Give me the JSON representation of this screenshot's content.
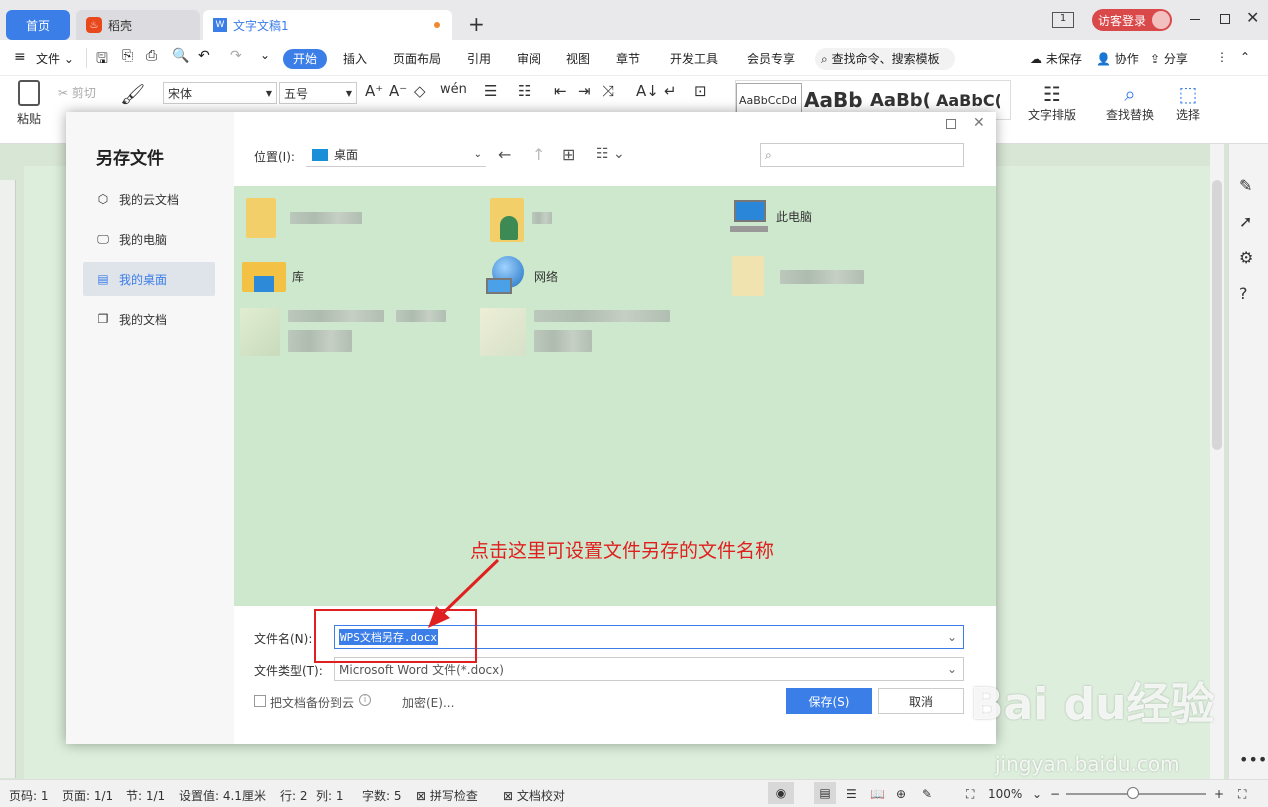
{
  "tabs": {
    "home": "首页",
    "daoke": "稻壳",
    "doc": "文字文稿1",
    "new_tab": "+"
  },
  "titlebar": {
    "page_badge": "1",
    "login": "访客登录"
  },
  "menu": {
    "file": "文件",
    "items": [
      "开始",
      "插入",
      "页面布局",
      "引用",
      "审阅",
      "视图",
      "章节",
      "开发工具",
      "会员专享"
    ],
    "search": "查找命令、搜索模板",
    "unsaved": "未保存",
    "collab": "协作",
    "share": "分享"
  },
  "ribbon": {
    "paste": "粘贴",
    "cut": "剪切",
    "font": "宋体",
    "size": "五号",
    "styles": [
      "AaBbCcDd",
      "AaBb",
      "AaBb(",
      "AaBbC("
    ],
    "text_layout": "文字排版",
    "find_replace": "查找替换",
    "select": "选择"
  },
  "dialog": {
    "title": "另存文件",
    "sidebar": [
      "我的云文档",
      "我的电脑",
      "我的桌面",
      "我的文档"
    ],
    "location_label": "位置(I):",
    "location_value": "桌面",
    "files": {
      "this_pc": "此电脑",
      "library": "库",
      "network": "网络"
    },
    "filename_label": "文件名(N):",
    "filename_value": "WPS文档另存.docx",
    "filetype_label": "文件类型(T):",
    "filetype_value": "Microsoft Word 文件(*.docx)",
    "backup": "把文档备份到云",
    "encrypt": "加密(E)...",
    "save": "保存(S)",
    "cancel": "取消"
  },
  "annotation": "点击这里可设置文件另存的文件名称",
  "status": {
    "page": "页码: 1",
    "pages": "页面: 1/1",
    "section": "节: 1/1",
    "setting": "设置值: 4.1厘米",
    "row": "行: 2",
    "col": "列: 1",
    "words": "字数: 5",
    "spell": "拼写检查",
    "proof": "文档校对",
    "zoom": "100%"
  },
  "watermark": {
    "brand": "Bai du经验",
    "url": "jingyan.baidu.com"
  },
  "colors": {
    "accent": "#3b7ee8",
    "annotation": "#e02020",
    "file_area": "#cde8cc"
  }
}
